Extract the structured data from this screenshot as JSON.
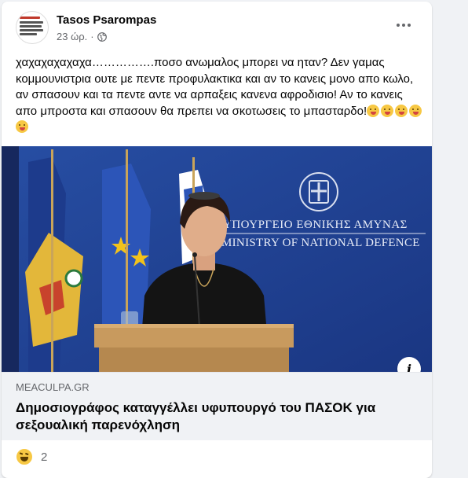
{
  "post": {
    "author": "Tasos Psarompas",
    "time": "23 ώρ.",
    "separator": "·",
    "privacy_icon": "globe-icon",
    "more_icon": "more-options-icon",
    "text": "χαχαχαχαχαχα…………….ποσο ανωμαλος μπορει να ηταν? Δεν γαμας κομμουνιστρια ουτε με πεντε προφυλακτικα και αν το κανεις μονο απο κωλο, αν σπασουν και τα πεντε αντε να αρπαξεις κανενα αφροδισιο! Αν το κανεις απο μπροστα και σπασουν θα πρεπει να σκοτωσεις το μπασταρδο!",
    "emoji_count": 5,
    "emoji_icon": "squinting-tongue-emoji"
  },
  "photo": {
    "sign_line1": "ΥΠΟΥΡΓΕΙΟ ΕΘΝΙΚΗΣ ΑΜΥΝΑΣ",
    "sign_line2": "MINISTRY OF NATIONAL DEFENCE",
    "info_label": "i"
  },
  "link": {
    "domain": "MEACULPA.GR",
    "title": "Δημοσιογράφος καταγγέλλει υφυπουργό του ΠΑΣΟΚ για σεξουαλική παρενόχληση"
  },
  "reactions": {
    "icon": "haha-reaction-icon",
    "count": "2"
  },
  "colors": {
    "background": "#f0f2f5",
    "card": "#ffffff",
    "secondary_text": "#65676b",
    "primary_text": "#050505",
    "backdrop_blue": "#1f3f8f"
  }
}
